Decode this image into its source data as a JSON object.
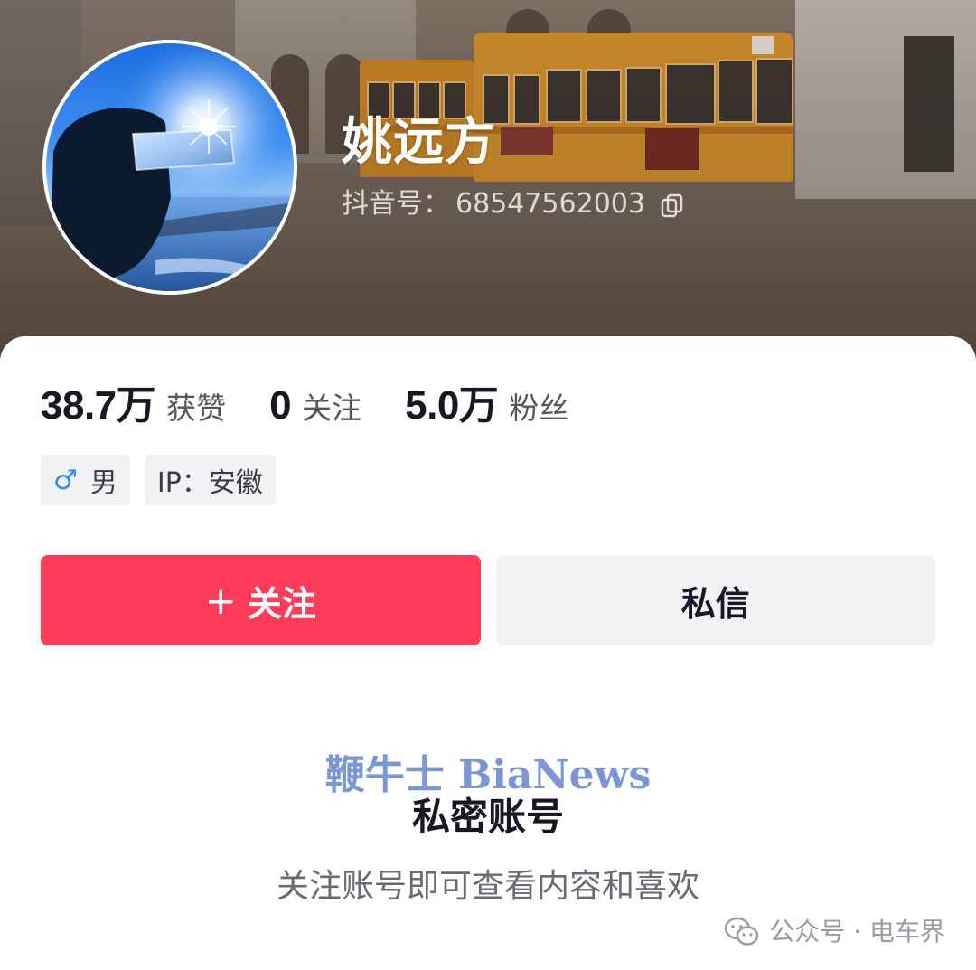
{
  "profile": {
    "nickname": "姚远方",
    "account_id_label": "抖音号：",
    "account_id": "68547562003"
  },
  "stats": [
    {
      "value": "38.7万",
      "label": "获赞"
    },
    {
      "value": "0",
      "label": "关注"
    },
    {
      "value": "5.0万",
      "label": "粉丝"
    }
  ],
  "tags": {
    "gender_icon": "male-icon",
    "gender": "男",
    "ip": "IP：安徽"
  },
  "actions": {
    "follow_plus": "+",
    "follow_label": "关注",
    "message_label": "私信"
  },
  "private": {
    "watermark": "鞭牛士 BiaNews",
    "title": "私密账号",
    "subtitle": "关注账号即可查看内容和喜欢"
  },
  "footer": {
    "source_icon": "wechat-icon",
    "source_text": "公众号 · 电车界"
  },
  "colors": {
    "follow_button": "#fe3b59",
    "secondary_button": "#f2f2f4",
    "primary_text": "#161823",
    "male_icon": "#2e8cf0"
  }
}
